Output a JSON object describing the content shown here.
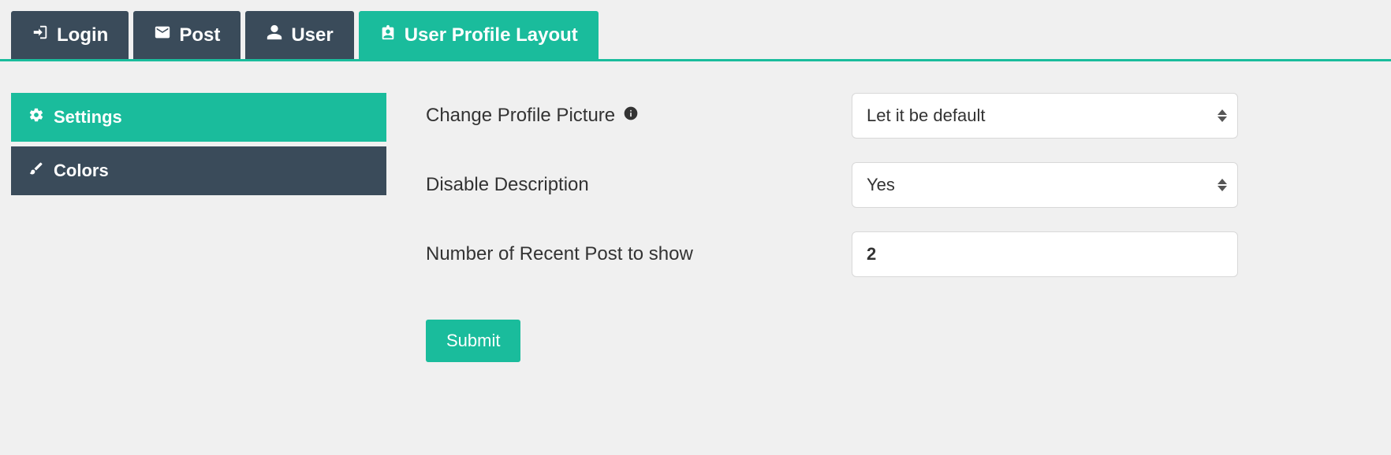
{
  "tabs": [
    {
      "label": "Login",
      "icon": "login"
    },
    {
      "label": "Post",
      "icon": "envelope"
    },
    {
      "label": "User",
      "icon": "user"
    },
    {
      "label": "User Profile Layout",
      "icon": "id-badge",
      "active": true
    }
  ],
  "sidebar": {
    "items": [
      {
        "label": "Settings",
        "icon": "cogs",
        "active": true
      },
      {
        "label": "Colors",
        "icon": "brush",
        "active": false
      }
    ]
  },
  "form": {
    "change_picture": {
      "label": "Change Profile Picture",
      "value": "Let it be default"
    },
    "disable_description": {
      "label": "Disable Description",
      "value": "Yes"
    },
    "recent_posts": {
      "label": "Number of Recent Post to show",
      "value": "2"
    },
    "submit_label": "Submit"
  }
}
